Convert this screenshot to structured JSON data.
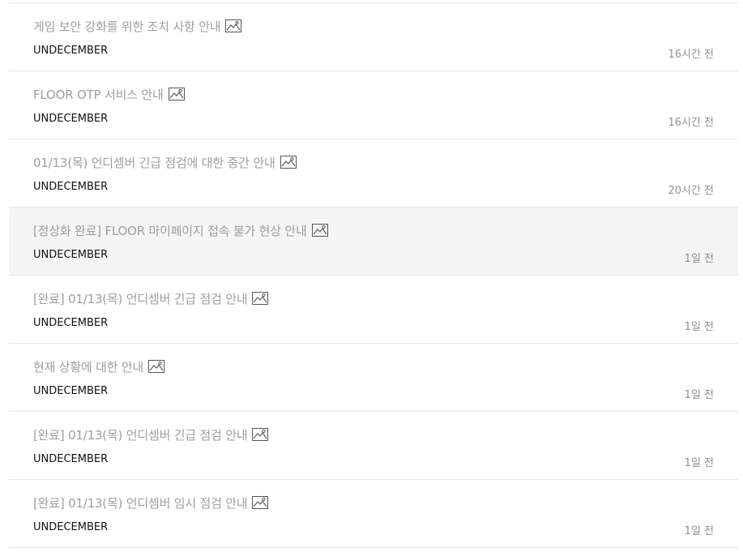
{
  "colors": {
    "title": "#9e9e9e",
    "author": "#111111",
    "time": "#8f8f8f",
    "divider": "#e5e5e5",
    "hover_bg": "#f5f5f5"
  },
  "posts": [
    {
      "title": "게임 보안 강화를 위한 조치 사항 안내",
      "author": "UNDECEMBER",
      "time": "16시간 전",
      "has_image": true,
      "icon": "image-icon"
    },
    {
      "title": "FLOOR OTP 서비스 안내",
      "author": "UNDECEMBER",
      "time": "16시간 전",
      "has_image": true,
      "icon": "image-icon"
    },
    {
      "title": "01/13(목) 언디셈버 긴급 점검에 대한 중간 안내",
      "author": "UNDECEMBER",
      "time": "20시간 전",
      "has_image": true,
      "icon": "image-icon"
    },
    {
      "title": "[정상화 완료] FLOOR 마이페이지 접속 불가 현상 안내",
      "author": "UNDECEMBER",
      "time": "1일 전",
      "has_image": true,
      "icon": "image-icon"
    },
    {
      "title": "[완료] 01/13(목) 언디셈버 긴급 점검 안내",
      "author": "UNDECEMBER",
      "time": "1일 전",
      "has_image": true,
      "icon": "image-icon"
    },
    {
      "title": "현재 상황에 대한 안내",
      "author": "UNDECEMBER",
      "time": "1일 전",
      "has_image": true,
      "icon": "image-icon"
    },
    {
      "title": "[완료] 01/13(목) 언디셈버 긴급 점검 안내",
      "author": "UNDECEMBER",
      "time": "1일 전",
      "has_image": true,
      "icon": "image-icon"
    },
    {
      "title": "[완료] 01/13(목) 언디셈버 임시 점검 안내",
      "author": "UNDECEMBER",
      "time": "1일 전",
      "has_image": true,
      "icon": "image-icon"
    }
  ]
}
